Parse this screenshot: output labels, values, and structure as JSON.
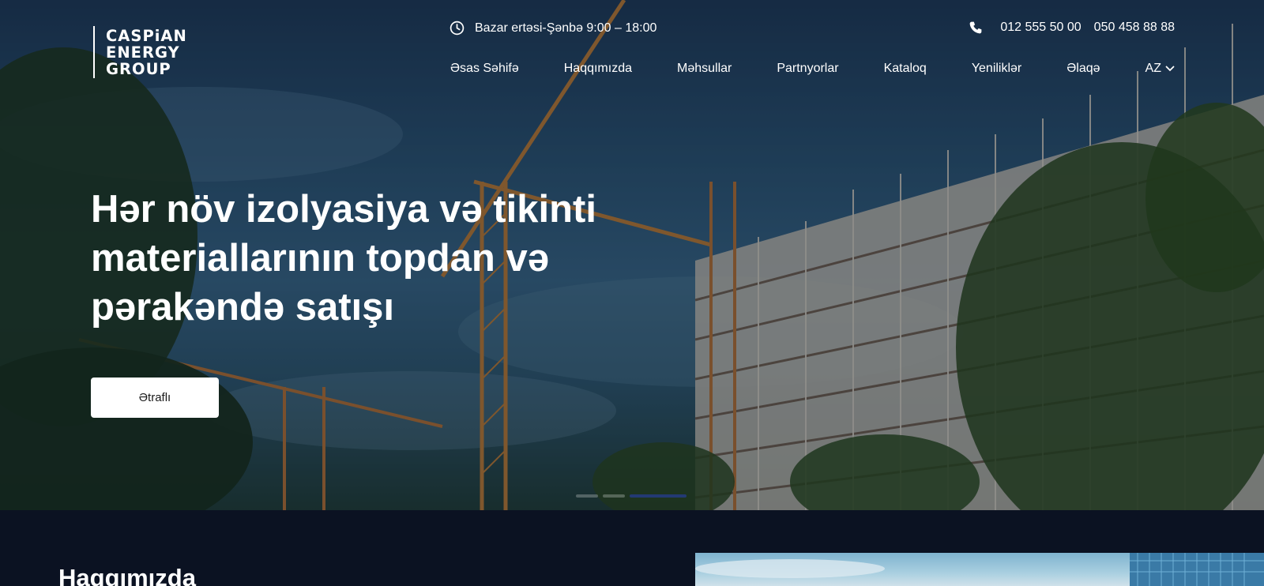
{
  "brand": {
    "line1": "CASPiAN",
    "line2": "ENERGY",
    "line3": "GROUP"
  },
  "header": {
    "hours": "Bazar ertəsi-Şənbə 9:00 – 18:00",
    "phones": [
      "012 555 50 00",
      "050 458 88 88"
    ],
    "icons": {
      "hours": "clock-icon",
      "phone": "phone-icon"
    }
  },
  "nav": {
    "items": [
      "Əsas Səhifə",
      "Haqqımızda",
      "Məhsullar",
      "Partnyorlar",
      "Kataloq",
      "Yeniliklər",
      "Əlaqə"
    ],
    "lang": "AZ"
  },
  "hero": {
    "title": "Hər növ izolyasiya və tikinti materiallarının topdan və pərakəndə satışı",
    "button": "Ətraflı",
    "slides": {
      "count": 3,
      "active": 3
    }
  },
  "about": {
    "title": "Haqqımızda"
  },
  "colors": {
    "accent": "#233a73",
    "background": "#0b1222",
    "button_bg": "#ffffff"
  }
}
